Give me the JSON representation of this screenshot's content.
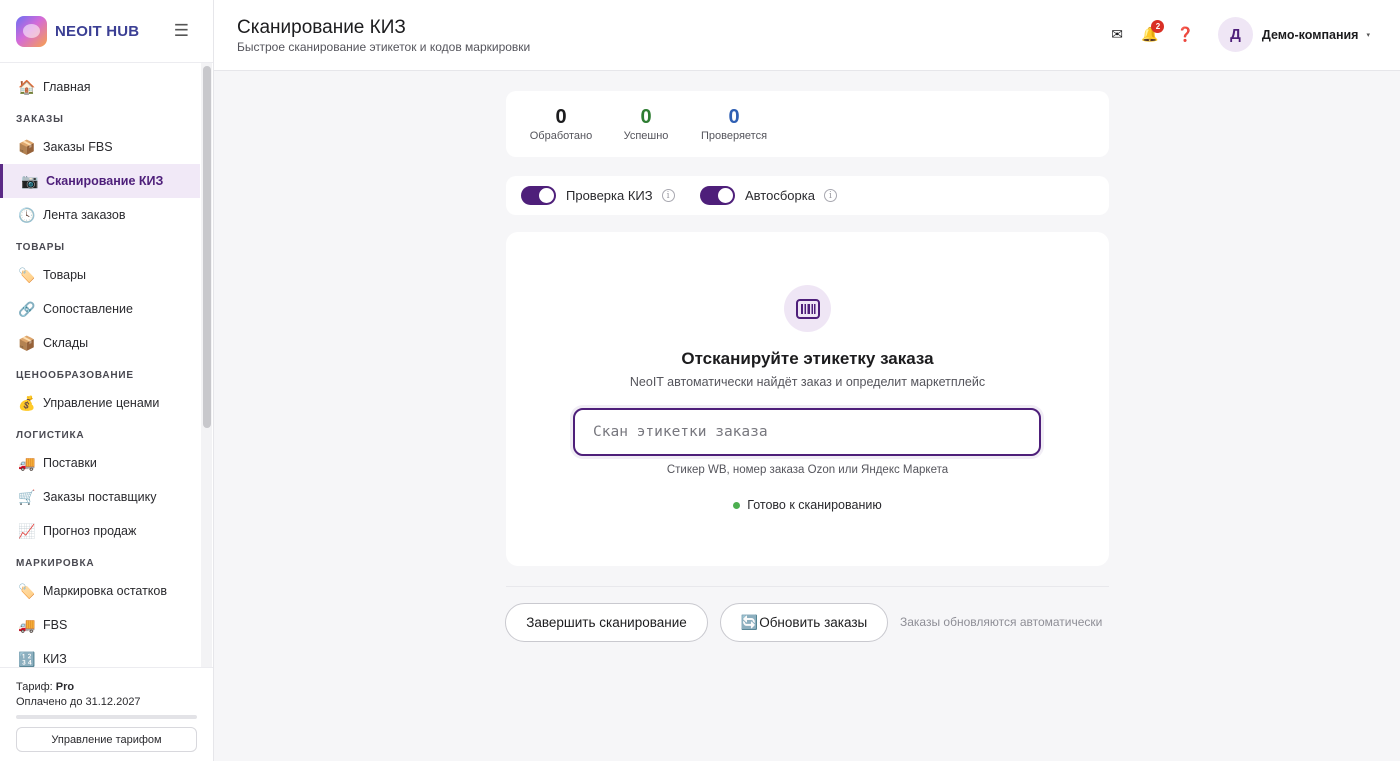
{
  "app": {
    "name": "NEOIT HUB"
  },
  "header": {
    "title": "Сканирование КИЗ",
    "subtitle": "Быстрое сканирование этикеток и кодов маркировки",
    "notifications_count": "2",
    "user_initial": "Д",
    "user_name": "Демо-компания"
  },
  "sidebar": {
    "home": {
      "icon": "🏠",
      "label": "Главная"
    },
    "sections": {
      "orders": "ЗАКАЗЫ",
      "goods": "ТОВАРЫ",
      "pricing": "ЦЕНООБРАЗОВАНИЕ",
      "logistics": "ЛОГИСТИКА",
      "marking": "МАРКИРОВКА"
    },
    "items": {
      "fbs_orders": {
        "icon": "📦",
        "label": "Заказы FBS"
      },
      "kiz_scan": {
        "icon": "📷",
        "label": "Сканирование КИЗ"
      },
      "order_feed": {
        "icon": "🕓",
        "label": "Лента заказов"
      },
      "products": {
        "icon": "🏷️",
        "label": "Товары"
      },
      "matching": {
        "icon": "🔗",
        "label": "Сопоставление"
      },
      "warehouses": {
        "icon": "📦",
        "label": "Склады"
      },
      "price_mgmt": {
        "icon": "💰",
        "label": "Управление ценами"
      },
      "supplies": {
        "icon": "🚚",
        "label": "Поставки"
      },
      "supplier_orders": {
        "icon": "🛒",
        "label": "Заказы поставщику"
      },
      "forecast": {
        "icon": "📈",
        "label": "Прогноз продаж"
      },
      "stock_marking": {
        "icon": "🏷️",
        "label": "Маркировка остатков"
      },
      "fbs": {
        "icon": "🚚",
        "label": "FBS"
      },
      "kiz": {
        "icon": "🔢",
        "label": "КИЗ"
      }
    },
    "tariff": {
      "label": "Тариф:",
      "plan": "Pro",
      "paid_until": "Оплачено до 31.12.2027",
      "manage_button": "Управление тарифом"
    }
  },
  "stats": [
    {
      "value": "0",
      "label": "Обработано",
      "color": "#1c1c1e"
    },
    {
      "value": "0",
      "label": "Успешно",
      "color": "#2e7d32"
    },
    {
      "value": "0",
      "label": "Проверяется",
      "color": "#2f5fb3"
    }
  ],
  "toggles": {
    "kiz_check": {
      "label": "Проверка КИЗ",
      "on": true
    },
    "auto_assembly": {
      "label": "Автосборка",
      "on": true
    }
  },
  "scan": {
    "title": "Отсканируйте этикетку заказа",
    "subtitle": "NeoIT автоматически найдёт заказ и определит маркетплейс",
    "input_placeholder": "Скан этикетки заказа",
    "input_value": "",
    "hint": "Стикер WB, номер заказа Ozon или Яндекс Маркета",
    "status": "Готово к сканированию"
  },
  "actions": {
    "finish_label": "Завершить сканирование",
    "refresh_icon": "🔄",
    "refresh_label": "Обновить заказы",
    "auto_note": "Заказы обновляются автоматически"
  },
  "colors": {
    "accent": "#4e1f7a",
    "status_ready": "#4caf50"
  }
}
